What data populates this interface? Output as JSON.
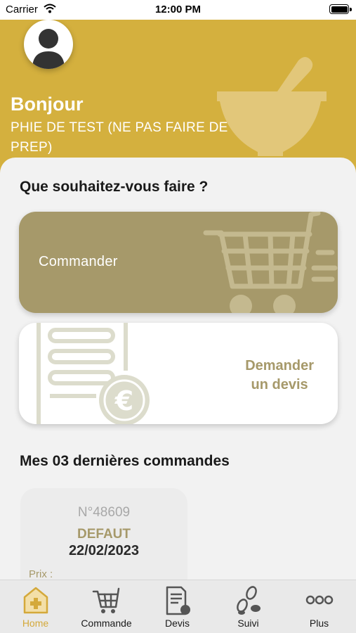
{
  "status_bar": {
    "carrier": "Carrier",
    "time": "12:00 PM"
  },
  "header": {
    "greeting": "Bonjour",
    "pharmacy_name": "PHIE DE TEST (NE PAS FAIRE DE PREP)",
    "background_color": "#d4b03e",
    "background_icon": "mortar-pestle-icon",
    "avatar_icon": "user-avatar-icon"
  },
  "actions": {
    "title": "Que souhaitez-vous faire ?",
    "order_label": "Commander",
    "order_icon": "shopping-cart-icon",
    "quote_label_line1": "Demander",
    "quote_label_line2": "un devis",
    "quote_icon": "invoice-euro-icon",
    "accent_color": "#a6996a"
  },
  "recent_orders": {
    "title": "Mes 03 dernières commandes",
    "orders": [
      {
        "number": "N°48609",
        "type": "DEFAUT",
        "date": "22/02/2023",
        "price_label": "Prix :"
      }
    ]
  },
  "tabbar": {
    "active_color": "#d4a93b",
    "tabs": [
      {
        "label": "Home",
        "icon": "home-plus-icon",
        "active": true
      },
      {
        "label": "Commande",
        "icon": "cart-icon",
        "active": false
      },
      {
        "label": "Devis",
        "icon": "document-icon",
        "active": false
      },
      {
        "label": "Suivi",
        "icon": "footsteps-icon",
        "active": false
      },
      {
        "label": "Plus",
        "icon": "more-dots-icon",
        "active": false
      }
    ]
  }
}
